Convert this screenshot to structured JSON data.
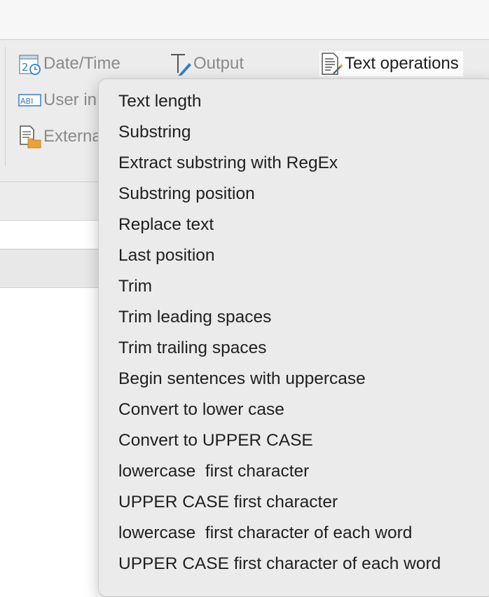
{
  "toolbar": {
    "date_time_label": "Date/Time",
    "output_label": "Output",
    "text_operations_label": "Text operations",
    "user_input_label": "User in",
    "external_label": "Externa"
  },
  "menu": {
    "items": [
      "Text length",
      "Substring",
      "Extract substring with RegEx",
      "Substring position",
      "Replace text",
      "Last position",
      "Trim",
      "Trim leading spaces",
      "Trim trailing spaces",
      "Begin sentences with uppercase",
      "Convert to lower case",
      "Convert to UPPER CASE",
      "lowercase  first character",
      "UPPER CASE first character",
      "lowercase  first character of each word",
      "UPPER CASE first character of each word"
    ]
  },
  "icons": {
    "date_time": "calendar-clock-icon",
    "output": "text-cursor-pencil-icon",
    "text_operations": "document-wand-icon",
    "user_input": "text-field-icon",
    "external": "document-folder-icon"
  },
  "colors": {
    "toolbar_bg": "#ececec",
    "menu_bg": "#ebebeb",
    "disabled_text": "#8a8a8a",
    "active_text": "#1d1d1d",
    "icon_blue": "#2f7ec9",
    "icon_orange": "#e8a23a"
  }
}
